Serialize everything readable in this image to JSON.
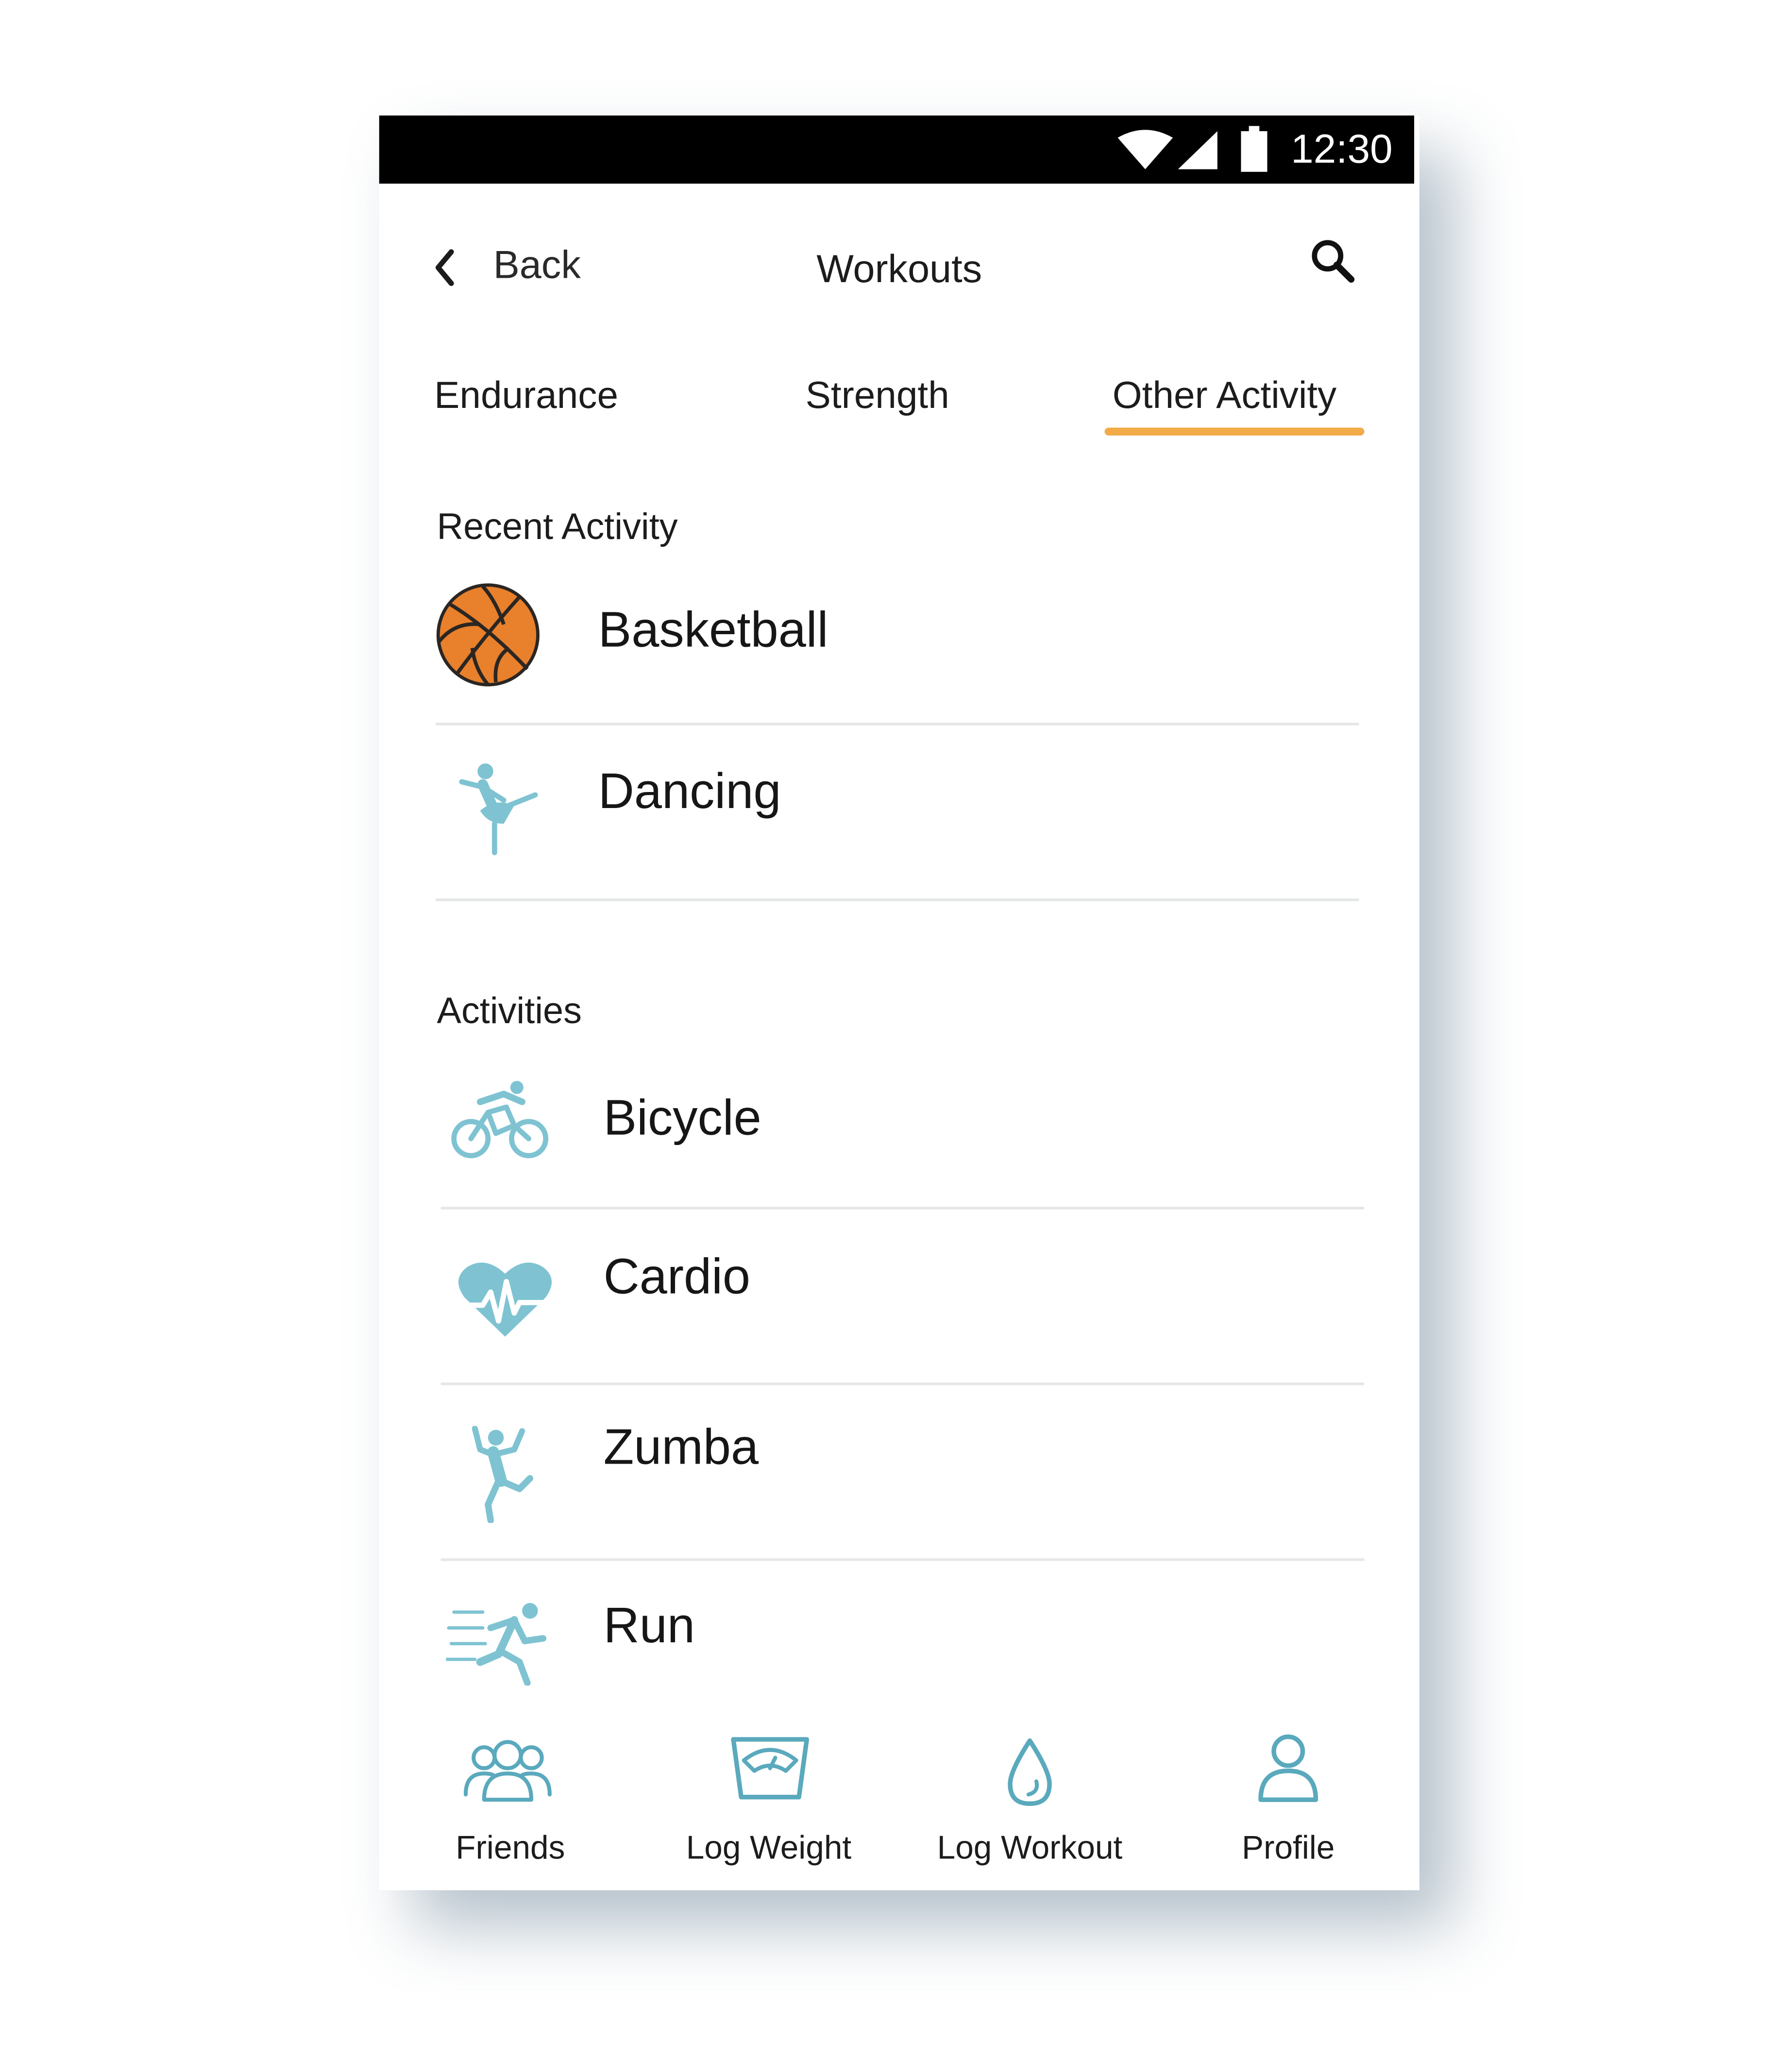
{
  "status_bar": {
    "time": "12:30"
  },
  "header": {
    "back_label": "Back",
    "title": "Workouts"
  },
  "tabs": [
    {
      "label": "Endurance",
      "active": false
    },
    {
      "label": "Strength",
      "active": false
    },
    {
      "label": "Other Activity",
      "active": true
    }
  ],
  "recent": {
    "title": "Recent Activity",
    "items": [
      {
        "label": "Basketball",
        "icon": "basketball-icon"
      },
      {
        "label": "Dancing",
        "icon": "dancer-icon"
      }
    ]
  },
  "activities": {
    "title": "Activities",
    "items": [
      {
        "label": "Bicycle",
        "icon": "bicycle-icon"
      },
      {
        "label": "Cardio",
        "icon": "heart-pulse-icon"
      },
      {
        "label": "Zumba",
        "icon": "zumba-dancer-icon"
      },
      {
        "label": "Run",
        "icon": "runner-icon"
      }
    ]
  },
  "bottom_nav": [
    {
      "label": "Friends",
      "icon": "friends-icon"
    },
    {
      "label": "Log Weight",
      "icon": "scale-icon"
    },
    {
      "label": "Log Workout",
      "icon": "water-drop-icon"
    },
    {
      "label": "Profile",
      "icon": "user-icon"
    }
  ],
  "colors": {
    "accent": "#f2ab48",
    "icon": "#7fc3d2",
    "nav_icon": "#5aa9bd",
    "basketball": "#e8802c"
  }
}
